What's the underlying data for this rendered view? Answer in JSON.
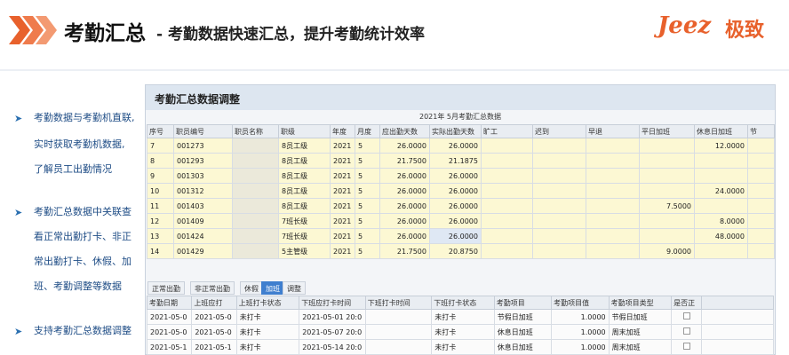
{
  "header": {
    "title_main": "考勤汇总",
    "title_sub": "- 考勤数据快速汇总，提升考勤统计效率",
    "logo_latin": "Jeez",
    "logo_cn": "极致"
  },
  "bullets": [
    {
      "lines": [
        "考勤数据与考勤机直联,",
        "实时获取考勤机数据,",
        "了解员工出勤情况"
      ]
    },
    {
      "lines": [
        "考勤汇总数据中关联查",
        "看正常出勤打卡、非正",
        "常出勤打卡、休假、加",
        "班、考勤调整等数据"
      ]
    },
    {
      "lines": [
        "支持考勤汇总数据调整"
      ]
    }
  ],
  "panel": {
    "title": "考勤汇总数据调整",
    "caption": "2021年   5月考勤汇总数据"
  },
  "summary_table": {
    "headers": [
      "序号",
      "职员编号",
      "职员名称",
      "职级",
      "年度",
      "月度",
      "应出勤天数",
      "实际出勤天数",
      "旷工",
      "迟到",
      "早退",
      "平日加班",
      "休息日加班",
      "节"
    ],
    "rows": [
      [
        "7",
        "001273",
        "",
        "8员工级",
        "2021",
        "5",
        "26.0000",
        "26.0000",
        "",
        "",
        "",
        "",
        "12.0000",
        ""
      ],
      [
        "8",
        "001293",
        "",
        "8员工级",
        "2021",
        "5",
        "21.7500",
        "21.1875",
        "",
        "",
        "",
        "",
        "",
        ""
      ],
      [
        "9",
        "001303",
        "",
        "8员工级",
        "2021",
        "5",
        "26.0000",
        "26.0000",
        "",
        "",
        "",
        "",
        "",
        ""
      ],
      [
        "10",
        "001312",
        "",
        "8员工级",
        "2021",
        "5",
        "26.0000",
        "26.0000",
        "",
        "",
        "",
        "",
        "24.0000",
        ""
      ],
      [
        "11",
        "001403",
        "",
        "8员工级",
        "2021",
        "5",
        "26.0000",
        "26.0000",
        "",
        "",
        "",
        "7.5000",
        "",
        ""
      ],
      [
        "12",
        "001409",
        "",
        "7班长级",
        "2021",
        "5",
        "26.0000",
        "26.0000",
        "",
        "",
        "",
        "",
        "8.0000",
        ""
      ],
      [
        "13",
        "001424",
        "",
        "7班长级",
        "2021",
        "5",
        "26.0000",
        "26.0000",
        "",
        "",
        "",
        "",
        "48.0000",
        ""
      ],
      [
        "14",
        "001429",
        "",
        "5主管级",
        "2021",
        "5",
        "21.7500",
        "20.8750",
        "",
        "",
        "",
        "9.0000",
        "",
        ""
      ]
    ]
  },
  "tabs": [
    "正常出勤",
    "非正常出勤",
    "休假",
    "加班",
    "调整"
  ],
  "active_tab": "加班",
  "detail_table": {
    "headers": [
      "考勤日期",
      "上班应打",
      "上班打卡状态",
      "下班应打卡时间",
      "下班打卡时间",
      "下班打卡状态",
      "考勤项目",
      "考勤项目值",
      "考勤项目类型",
      "是否正",
      ""
    ],
    "rows": [
      [
        "2021-05-0",
        "2021-05-0",
        "未打卡",
        "2021-05-01 20:0",
        "",
        "未打卡",
        "节假日加班",
        "1.0000",
        "节假日加班",
        "",
        ""
      ],
      [
        "2021-05-0",
        "2021-05-0",
        "未打卡",
        "2021-05-07 20:0",
        "",
        "未打卡",
        "休息日加班",
        "1.0000",
        "周末加班",
        "",
        ""
      ],
      [
        "2021-05-1",
        "2021-05-1",
        "未打卡",
        "2021-05-14 20:0",
        "",
        "未打卡",
        "休息日加班",
        "1.0000",
        "周末加班",
        "",
        ""
      ]
    ]
  },
  "colors": {
    "accent_orange": "#e8612c",
    "bullet_blue": "#1f4d86",
    "grid_yellow": "#fcf8d3",
    "tab_active": "#3f7fcf"
  }
}
